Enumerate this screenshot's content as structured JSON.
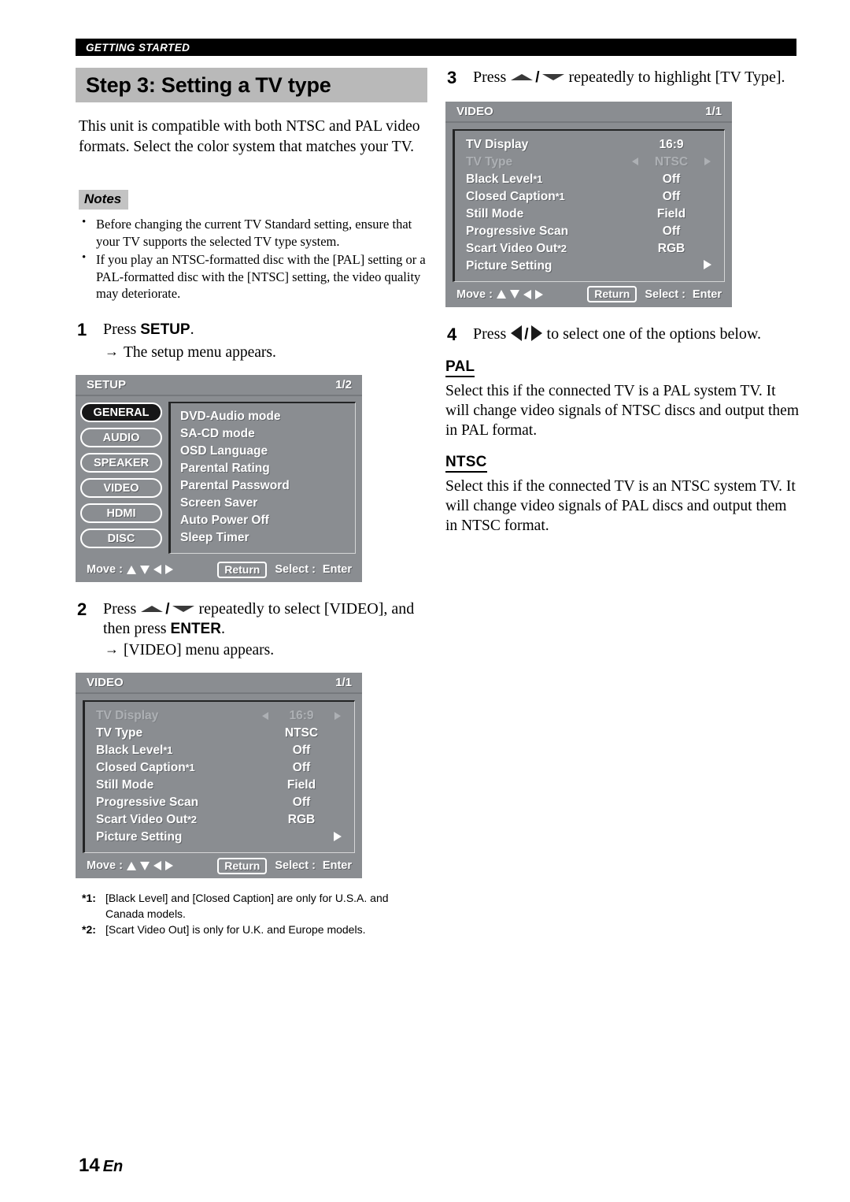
{
  "page": {
    "running_header": "GETTING STARTED",
    "page_number": "14",
    "language_code": "En"
  },
  "step_title": "Step 3: Setting a TV type",
  "intro": "This unit is compatible with both NTSC and PAL video formats. Select the color system that matches your TV.",
  "notes": {
    "badge": "Notes",
    "items": [
      "Before changing the current TV Standard setting, ensure that your TV supports the selected TV type system.",
      "If you play an NTSC-formatted disc with the [PAL] setting or a PAL-formatted disc with the [NTSC] setting, the video quality may deteriorate."
    ]
  },
  "steps": {
    "one": {
      "num": "1",
      "text_before": "Press ",
      "bold": "SETUP",
      "text_after": ".",
      "result": "The setup menu appears.",
      "arrow": "→"
    },
    "two": {
      "num": "2",
      "text_before": "Press ",
      "text_mid": " repeatedly to select [VIDEO], and then press ",
      "bold": "ENTER",
      "text_after": ".",
      "result": "[VIDEO] menu appears.",
      "arrow": "→"
    },
    "three": {
      "num": "3",
      "text_before": "Press ",
      "text_after": " repeatedly to highlight [TV Type]."
    },
    "four": {
      "num": "4",
      "text_before": "Press ",
      "text_after": " to select one of the options below."
    }
  },
  "setup_menu": {
    "title": "SETUP",
    "page_indicator": "1/2",
    "tabs": [
      {
        "label": "GENERAL",
        "selected": true
      },
      {
        "label": "AUDIO",
        "selected": false
      },
      {
        "label": "SPEAKER",
        "selected": false
      },
      {
        "label": "VIDEO",
        "selected": false
      },
      {
        "label": "HDMI",
        "selected": false
      },
      {
        "label": "DISC",
        "selected": false
      }
    ],
    "items": [
      "DVD-Audio mode",
      "SA-CD mode",
      "OSD Language",
      "Parental Rating",
      "Parental Password",
      "Screen Saver",
      "Auto Power Off",
      "Sleep Timer"
    ],
    "footer": {
      "move_label": "Move :",
      "return_label": "Return",
      "select_label": "Select :",
      "enter_label": "Enter"
    }
  },
  "video_menu_1": {
    "title": "VIDEO",
    "page_indicator": "1/1",
    "rows": [
      {
        "label": "TV Display",
        "sup": "",
        "value": "16:9",
        "highlighted": true,
        "submenu": false
      },
      {
        "label": "TV Type",
        "sup": "",
        "value": "NTSC",
        "highlighted": false,
        "submenu": false
      },
      {
        "label": "Black Level",
        "sup": "*1",
        "value": "Off",
        "highlighted": false,
        "submenu": false
      },
      {
        "label": "Closed Caption",
        "sup": "*1",
        "value": "Off",
        "highlighted": false,
        "submenu": false
      },
      {
        "label": "Still Mode",
        "sup": "",
        "value": "Field",
        "highlighted": false,
        "submenu": false
      },
      {
        "label": "Progressive Scan",
        "sup": "",
        "value": "Off",
        "highlighted": false,
        "submenu": false
      },
      {
        "label": "Scart Video Out",
        "sup": "*2",
        "value": "RGB",
        "highlighted": false,
        "submenu": false
      },
      {
        "label": "Picture Setting",
        "sup": "",
        "value": "",
        "highlighted": false,
        "submenu": true
      }
    ],
    "footer": {
      "move_label": "Move :",
      "return_label": "Return",
      "select_label": "Select :",
      "enter_label": "Enter"
    }
  },
  "video_menu_2": {
    "title": "VIDEO",
    "page_indicator": "1/1",
    "rows": [
      {
        "label": "TV Display",
        "sup": "",
        "value": "16:9",
        "highlighted": false,
        "submenu": false
      },
      {
        "label": "TV Type",
        "sup": "",
        "value": "NTSC",
        "highlighted": true,
        "submenu": false
      },
      {
        "label": "Black Level",
        "sup": "*1",
        "value": "Off",
        "highlighted": false,
        "submenu": false
      },
      {
        "label": "Closed Caption",
        "sup": "*1",
        "value": "Off",
        "highlighted": false,
        "submenu": false
      },
      {
        "label": "Still Mode",
        "sup": "",
        "value": "Field",
        "highlighted": false,
        "submenu": false
      },
      {
        "label": "Progressive Scan",
        "sup": "",
        "value": "Off",
        "highlighted": false,
        "submenu": false
      },
      {
        "label": "Scart Video Out",
        "sup": "*2",
        "value": "RGB",
        "highlighted": false,
        "submenu": false
      },
      {
        "label": "Picture Setting",
        "sup": "",
        "value": "",
        "highlighted": false,
        "submenu": true
      }
    ],
    "footer": {
      "move_label": "Move :",
      "return_label": "Return",
      "select_label": "Select :",
      "enter_label": "Enter"
    }
  },
  "footnotes": [
    {
      "marker": "*1:",
      "text": "[Black Level] and [Closed Caption] are only for U.S.A. and Canada models."
    },
    {
      "marker": "*2:",
      "text": "[Scart Video Out] is only for U.K. and Europe models."
    }
  ],
  "options": [
    {
      "heading": "PAL",
      "body": "Select this if the connected TV is a PAL system TV. It will change video signals of NTSC discs and output them in PAL format."
    },
    {
      "heading": "NTSC",
      "body": "Select this if the connected TV is an NTSC system TV. It will change video signals of PAL discs and output them in NTSC format."
    }
  ],
  "colors": {
    "header_bar": "#000000",
    "title_band": "#b9b9b9",
    "osd_grey": "#8a8d91",
    "osd_dim_text": "#adb0b4",
    "osd_selected_tab": "#161617"
  }
}
